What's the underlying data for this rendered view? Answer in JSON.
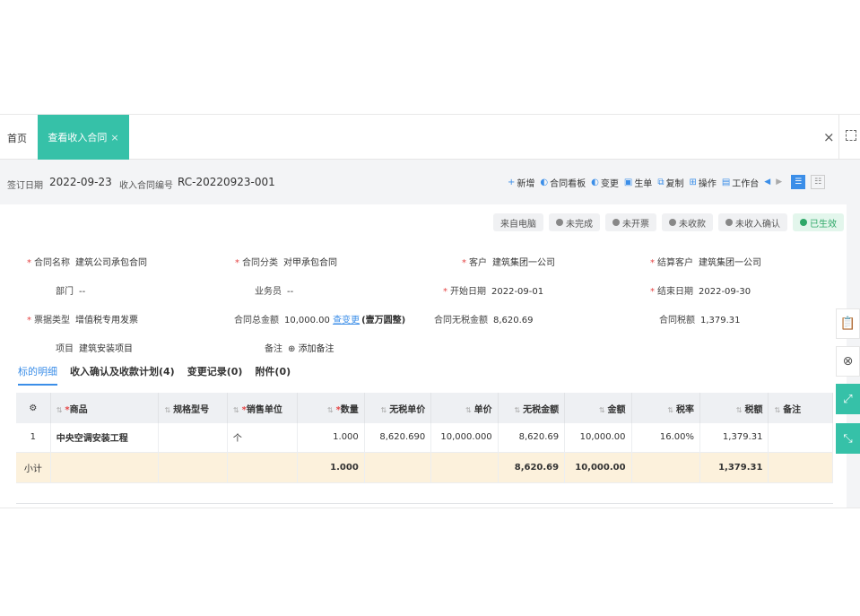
{
  "tabs": {
    "home": "首页",
    "active": "查看收入合同",
    "close": "×"
  },
  "window": {
    "close": "×"
  },
  "meta": {
    "sign_date_label": "签订日期",
    "sign_date": "2022-09-23",
    "contract_no_label": "收入合同编号",
    "contract_no": "RC-20220923-001"
  },
  "toolbar": {
    "add": "新增",
    "board": "合同看板",
    "change": "变更",
    "generate": "生单",
    "copy": "复制",
    "ops": "操作",
    "workbench": "工作台"
  },
  "status": [
    "来自电脑",
    "未完成",
    "未开票",
    "未收款",
    "未收入确认",
    "已生效"
  ],
  "fields": {
    "name_k": "合同名称",
    "name_v": "建筑公司承包合同",
    "type_k": "合同分类",
    "type_v": "对甲承包合同",
    "cust_k": "客户",
    "cust_v": "建筑集团一公司",
    "settle_k": "结算客户",
    "settle_v": "建筑集团一公司",
    "dept_k": "部门",
    "dept_v": "--",
    "sales_k": "业务员",
    "sales_v": "--",
    "start_k": "开始日期",
    "start_v": "2022-09-01",
    "end_k": "结束日期",
    "end_v": "2022-09-30",
    "bill_k": "票据类型",
    "bill_v": "增值税专用发票",
    "total_k": "合同总金额",
    "total_v": "10,000.00",
    "total_link": "查变更",
    "total_cn": "(壹万圆整)",
    "notax_k": "合同无税金额",
    "notax_v": "8,620.69",
    "tax_k": "合同税额",
    "tax_v": "1,379.31",
    "proj_k": "项目",
    "proj_v": "建筑安装项目",
    "note_k": "备注",
    "note_v": "添加备注"
  },
  "subtabs": [
    "标的明细",
    "收入确认及收款计划(4)",
    "变更记录(0)",
    "附件(0)"
  ],
  "table": {
    "headers": [
      "商品",
      "规格型号",
      "销售单位",
      "数量",
      "无税单价",
      "单价",
      "无税金额",
      "金额",
      "税率",
      "税额",
      "备注"
    ],
    "rows": [
      [
        "1",
        "中央空调安装工程",
        "",
        "个",
        "1.000",
        "8,620.690",
        "10,000.000",
        "8,620.69",
        "10,000.00",
        "16.00%",
        "1,379.31",
        ""
      ]
    ],
    "subtotal": [
      "小计",
      "",
      "",
      "",
      "1.000",
      "",
      "",
      "8,620.69",
      "10,000.00",
      "",
      "1,379.31",
      ""
    ]
  }
}
